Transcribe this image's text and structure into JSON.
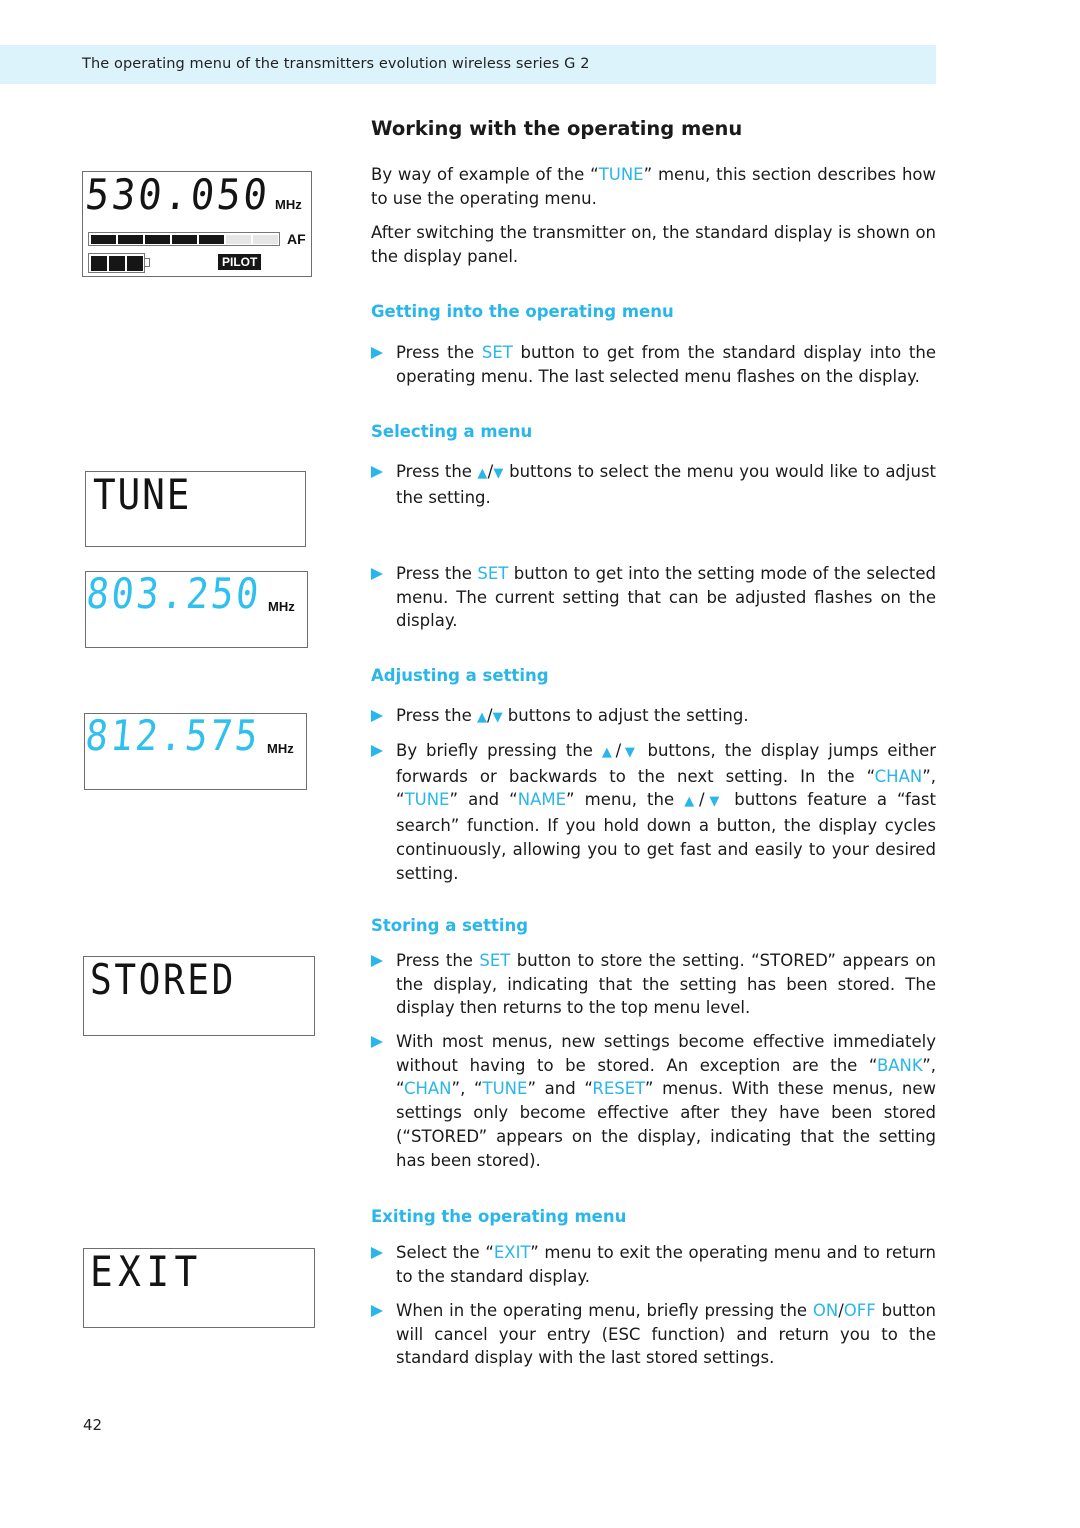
{
  "header": {
    "running_title": "The operating menu of the transmitters evolution wireless series G 2"
  },
  "colors": {
    "accent": "#29b6ea",
    "header_band": "#dcf3fc",
    "text": "#1a1a1a"
  },
  "displays": {
    "standard": {
      "frequency": "530.050",
      "unit": "MHz",
      "af_label": "AF",
      "af_level_segments_on": 5,
      "af_level_segments_total": 7,
      "battery_cells_on": 3,
      "battery_cells_total": 3,
      "pilot_label": "PILOT"
    },
    "tune": {
      "text": "TUNE"
    },
    "freq1": {
      "value": "803.250",
      "unit": "MHz"
    },
    "freq2": {
      "value": "812.575",
      "unit": "MHz"
    },
    "stored": {
      "text": "STORED"
    },
    "exit": {
      "text": "EXIT"
    }
  },
  "main": {
    "title": "Working with the operating menu",
    "intro": [
      {
        "parts": [
          "By way of example of the “",
          "TUNE",
          "” menu, this section describes how to use the operating menu."
        ]
      },
      {
        "parts": [
          "After switching the transmitter on, the standard display is shown on the display panel."
        ]
      }
    ],
    "sections": {
      "getting_into": {
        "heading": "Getting into the operating menu",
        "b1": [
          "Press the ",
          "SET",
          " button to get from the standard display into the operating menu. The last selected menu flashes on the display."
        ]
      },
      "selecting": {
        "heading": "Selecting a menu",
        "b1": [
          "Press the ",
          "▲",
          "/",
          "▼",
          " buttons to select the menu you would like to adjust the setting."
        ],
        "b2": [
          "Press the ",
          "SET",
          " button to get into the setting mode of the selected menu. The current setting that can be adjusted flashes on the display."
        ]
      },
      "adjusting": {
        "heading": "Adjusting a setting",
        "b1": [
          "Press the ",
          "▲",
          "/",
          "▼",
          " buttons to adjust the setting."
        ],
        "b2": [
          "By briefly pressing the ",
          "▲",
          "/",
          "▼",
          " buttons, the display jumps either forwards or backwards to the next setting. In the “",
          "CHAN",
          "”, “",
          "TUNE",
          "” and “",
          "NAME",
          "” menu, the ",
          "▲",
          "/",
          "▼",
          " buttons feature a “fast search” function. If you hold down a button, the display cycles continuously, allowing you to get fast and easily to your desired setting."
        ]
      },
      "storing": {
        "heading": "Storing a setting",
        "b1": [
          "Press the ",
          "SET",
          " button to store the setting. “STORED” appears on the display, indicating that the setting has been stored. The display then returns to the top menu level."
        ],
        "b2": [
          "With most menus, new settings become effective immediately without having to be stored. An exception are the “",
          "BANK",
          "”, “",
          "CHAN",
          "”, “",
          "TUNE",
          "” and “",
          "RESET",
          "” menus. With these menus, new settings only become effective after they have been stored (“STORED” appears on the display, indicating that the setting has been stored)."
        ]
      },
      "exiting": {
        "heading": "Exiting the operating menu",
        "b1": [
          "Select the “",
          "EXIT",
          "” menu to exit the operating menu and to return to the standard display."
        ],
        "b2": [
          "When in the operating menu, briefly pressing the ",
          "ON",
          "/",
          "OFF",
          " button will cancel your entry (ESC function) and return you to the standard display with the last stored settings."
        ]
      }
    }
  },
  "footer": {
    "page_number": "42"
  }
}
